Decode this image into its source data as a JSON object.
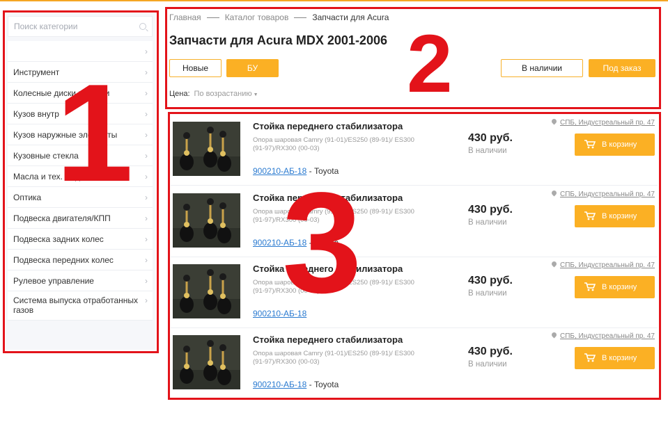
{
  "colors": {
    "accent": "#fbb024",
    "annotation": "#e3131a",
    "link": "#2a7ad0"
  },
  "sidebar": {
    "search_placeholder": "Поиск категории",
    "items": [
      {
        "label": ""
      },
      {
        "label": "Инструмент"
      },
      {
        "label": "Колесные диски и шинки"
      },
      {
        "label": "Кузов внутр"
      },
      {
        "label": "Кузов наружные элементы"
      },
      {
        "label": "Кузовные стекла"
      },
      {
        "label": "Масла и тех. жидкости"
      },
      {
        "label": "Оптика"
      },
      {
        "label": "Подвеска двигателя/КПП"
      },
      {
        "label": "Подвеска задних колес"
      },
      {
        "label": "Подвеска передних колес"
      },
      {
        "label": "Рулевое управление"
      },
      {
        "label": "Система выпуска отработанных газов"
      }
    ]
  },
  "breadcrumb": [
    "Главная",
    "Каталог товаров",
    "Запчасти для Acura"
  ],
  "title": "Запчасти для Acura MDX 2001-2006",
  "filters": {
    "new": "Новые",
    "used": "БУ",
    "in_stock": "В наличии",
    "on_order": "Под заказ"
  },
  "sort": {
    "label": "Цена:",
    "value": "По возрастанию"
  },
  "products": [
    {
      "name": "Стойка переднего стабилизатора",
      "description": "Опора шаровая Camry (91-01)/ES250 (89-91)/ ES300 (91-97)/RX300 (00-03)",
      "code": "900210-АБ-18",
      "brand": "- Toyota",
      "price": "430 руб.",
      "availability": "В наличии",
      "location": "СПБ, Индустреальный пр. 47",
      "cart_label": "В корзину"
    },
    {
      "name": "Стойка переднего стабилизатора",
      "description": "Опора шаровая Camry (91-01)/ES250 (89-91)/ ES300 (91-97)/RX300 (00-03)",
      "code": "900210-АБ-18",
      "brand": "- Toyota",
      "price": "430 руб.",
      "availability": "В наличии",
      "location": "СПБ, Индустреальный пр. 47",
      "cart_label": "В корзину"
    },
    {
      "name": "Стойка переднего стабилизатора",
      "description": "Опора шаровая Camry (91-01)/ES250 (89-91)/ ES300 (91-97)/RX300 (00-03)",
      "code": "900210-АБ-18",
      "brand": "",
      "price": "430 руб.",
      "availability": "В наличии",
      "location": "СПБ, Индустреальный пр. 47",
      "cart_label": "В корзину"
    },
    {
      "name": "Стойка переднего стабилизатора",
      "description": "Опора шаровая Camry (91-01)/ES250 (89-91)/ ES300 (91-97)/RX300 (00-03)",
      "code": "900210-АБ-18",
      "brand": "- Toyota",
      "price": "430 руб.",
      "availability": "В наличии",
      "location": "СПБ, Индустреальный пр. 47",
      "cart_label": "В корзину"
    }
  ],
  "annotations": [
    "1",
    "2",
    "3"
  ]
}
